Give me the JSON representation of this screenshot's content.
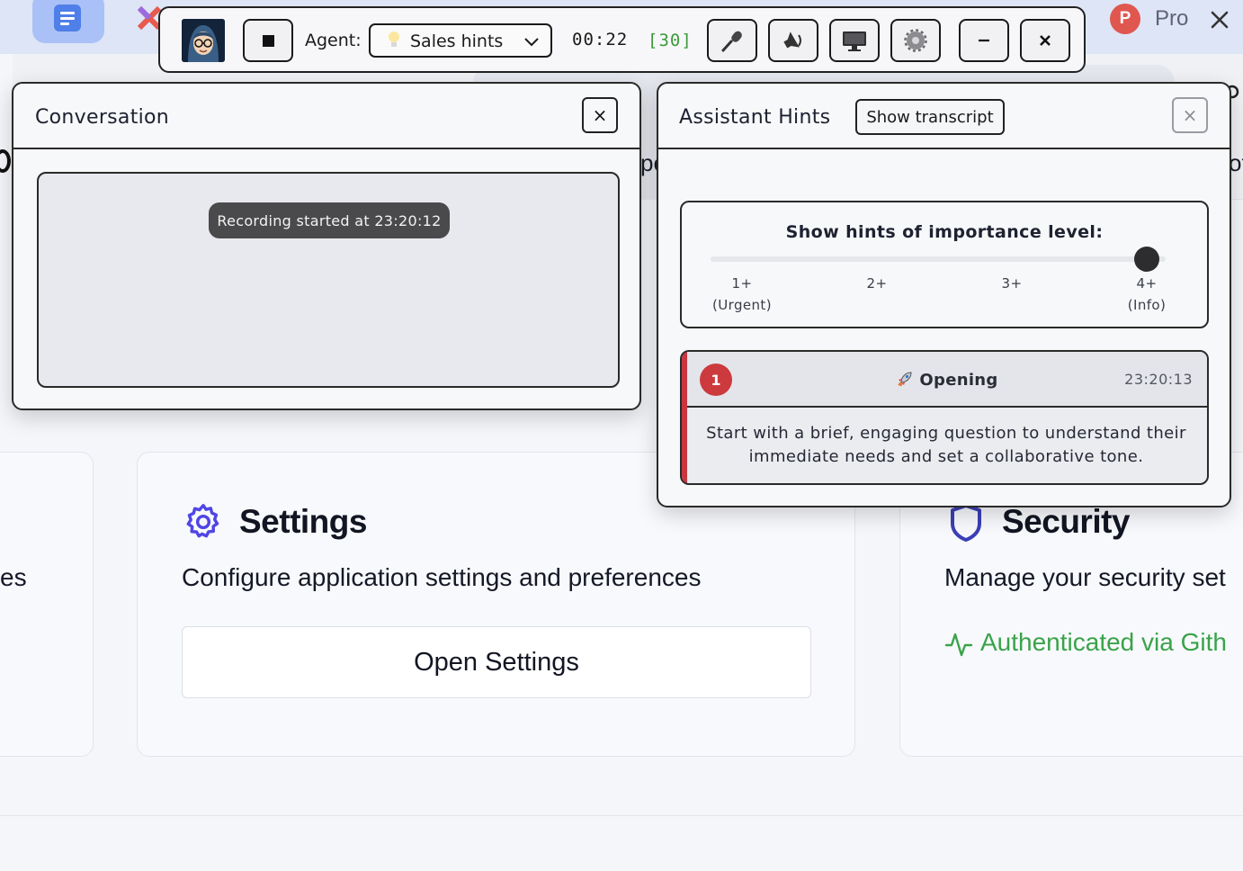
{
  "background": {
    "profile": {
      "initial": "P",
      "name": "Pro"
    },
    "edge_fragments": {
      "left_text": "pe",
      "right_text": "ot"
    },
    "cards": {
      "left_fragment": "es",
      "settings": {
        "title": "Settings",
        "description": "Configure application settings and preferences",
        "button": "Open Settings",
        "icon": "gear-icon",
        "icon_color": "#4f46e5"
      },
      "security": {
        "title": "Security",
        "description": "Manage your security set",
        "auth_status": "Authenticated via Gith",
        "icon": "shield-icon",
        "icon_color": "#3b3fb6",
        "status_color": "#3aa34a"
      }
    }
  },
  "toolbar": {
    "agent_label": "Agent:",
    "agent_value": "Sales hints",
    "timer": "00:22",
    "count": "[30]",
    "icons": [
      "avatar",
      "stop-icon",
      "microphone-icon",
      "speaker-icon",
      "monitor-icon",
      "gear-icon",
      "minimize-icon",
      "close-icon"
    ]
  },
  "conversation": {
    "title": "Conversation",
    "close": "×",
    "recording_status": "Recording started at 23:20:12"
  },
  "hints": {
    "title": "Assistant Hints",
    "transcript_button": "Show transcript",
    "close": "×",
    "importance": {
      "title": "Show hints of importance level:",
      "ticks": [
        {
          "label": "1+",
          "sub": "(Urgent)"
        },
        {
          "label": "2+",
          "sub": ""
        },
        {
          "label": "3+",
          "sub": ""
        },
        {
          "label": "4+",
          "sub": "(Info)"
        }
      ],
      "selected_level": 4
    },
    "items": [
      {
        "priority": "1",
        "category": "Opening",
        "category_icon": "rocket-icon",
        "time": "23:20:13",
        "text": "Start with a brief, engaging question to understand their immediate needs and set a collaborative tone.",
        "accent_color": "#c8373f"
      }
    ]
  }
}
